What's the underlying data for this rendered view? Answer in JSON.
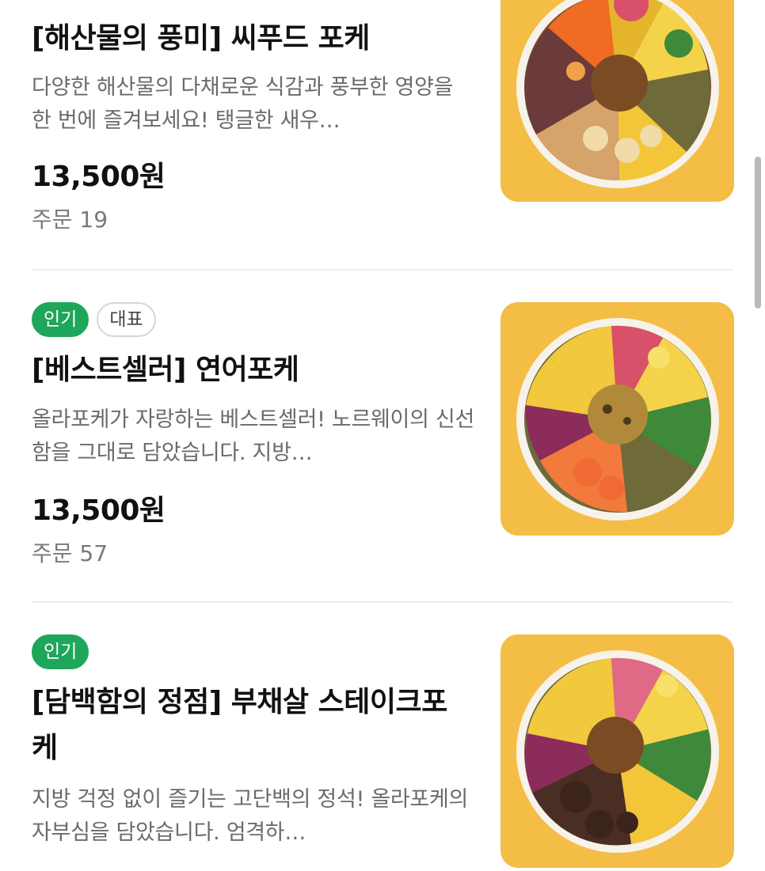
{
  "menu": {
    "items": [
      {
        "badges": [],
        "title": "[해산물의 풍미] 씨푸드 포케",
        "description": "다양한 해산물의 다채로운 식감과 풍부한 영양을 한 번에 즐겨보세요! 탱글한 새우…",
        "price": "13,500원",
        "orders": "주문 19",
        "image_icon": "seafood-poke-bowl-image"
      },
      {
        "badges": [
          "인기",
          "대표"
        ],
        "title": "[베스트셀러] 연어포케",
        "description": "올라포케가 자랑하는 베스트셀러! 노르웨이의 신선함을 그대로 담았습니다. 지방…",
        "price": "13,500원",
        "orders": "주문 57",
        "image_icon": "salmon-poke-bowl-image"
      },
      {
        "badges": [
          "인기"
        ],
        "title": "[담백함의 정점] 부채살 스테이크포케",
        "description": "지방 걱정 없이 즐기는 고단백의 정석! 올라포케의 자부심을 담았습니다. 엄격하…",
        "price": "",
        "orders": "",
        "image_icon": "steak-poke-bowl-image"
      }
    ]
  },
  "colors": {
    "badge_popular_bg": "#1ea65a",
    "badge_signature_border": "#d6d6d6",
    "thumb_bg": "#f4bd45",
    "text_primary": "#111111",
    "text_secondary": "#6b6b6b",
    "divider": "#eeeeee"
  }
}
